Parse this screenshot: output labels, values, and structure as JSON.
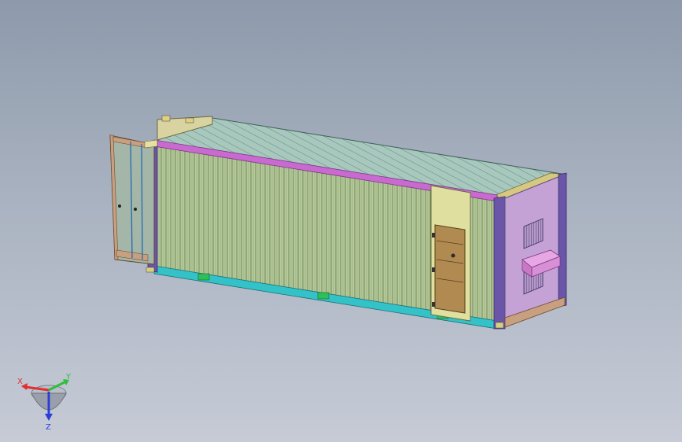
{
  "viewport": {
    "background_top": "#8d9aab",
    "background_bottom": "#c6cbd6"
  },
  "model": {
    "colors": {
      "side_panel": "#b6c99a",
      "side_rib_dark": "#6f8a5b",
      "roof": "#9dbfb4",
      "roof_rib": "#5e8a84",
      "bottom_rail": "#33c2c8",
      "corner_post": "#6a55a8",
      "top_rail": "#c86ad0",
      "end_wall": "#c5a2d6",
      "vent_grille": "#5d4f7a",
      "service_door": "#b08a50",
      "ac_unit": "#d88fd6",
      "door_frame": "#e8e0a0",
      "forklift_pocket": "#2fbf5a",
      "open_door_frame": "#c8a080"
    }
  },
  "triad": {
    "x_label": "X",
    "y_label": "Y",
    "z_label": "Z",
    "x_color": "#e03030",
    "y_color": "#2fbf3a",
    "z_color": "#2a3fd6"
  }
}
